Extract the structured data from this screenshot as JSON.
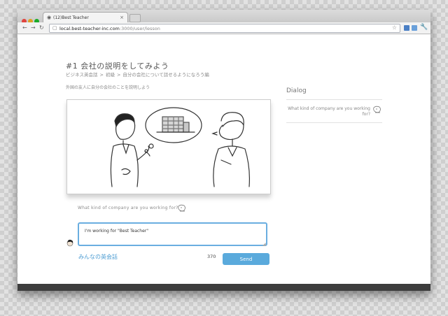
{
  "browser": {
    "tab_title": "(12)Best Teacher",
    "url_host": "local.best-teacher-inc.com",
    "url_path": ":3000/user/lesson"
  },
  "lesson": {
    "title": "#1 会社の説明をしてみよう",
    "breadcrumb": [
      "ビジネス英会話",
      "初級",
      "自分の会社について話せるようになろう編"
    ],
    "breadcrumb_sep": ">",
    "subtitle": "外国の友人に自分の会社のことを説明しよう",
    "prompt": "What kind of company are you working for?"
  },
  "answer": {
    "value": "I'm working for \"Best Teacher\"",
    "char_count": "370",
    "send_label": "Send"
  },
  "links": {
    "community": "みんなの英会話"
  },
  "dialog": {
    "title": "Dialog",
    "line": "What kind of company are you working for?"
  },
  "colors": {
    "accent": "#5aaadc",
    "link": "#4a9bd2",
    "footer": "#3d3d3d"
  },
  "icons": {
    "teacher": "teacher-face-icon",
    "user": "user-face-icon"
  }
}
